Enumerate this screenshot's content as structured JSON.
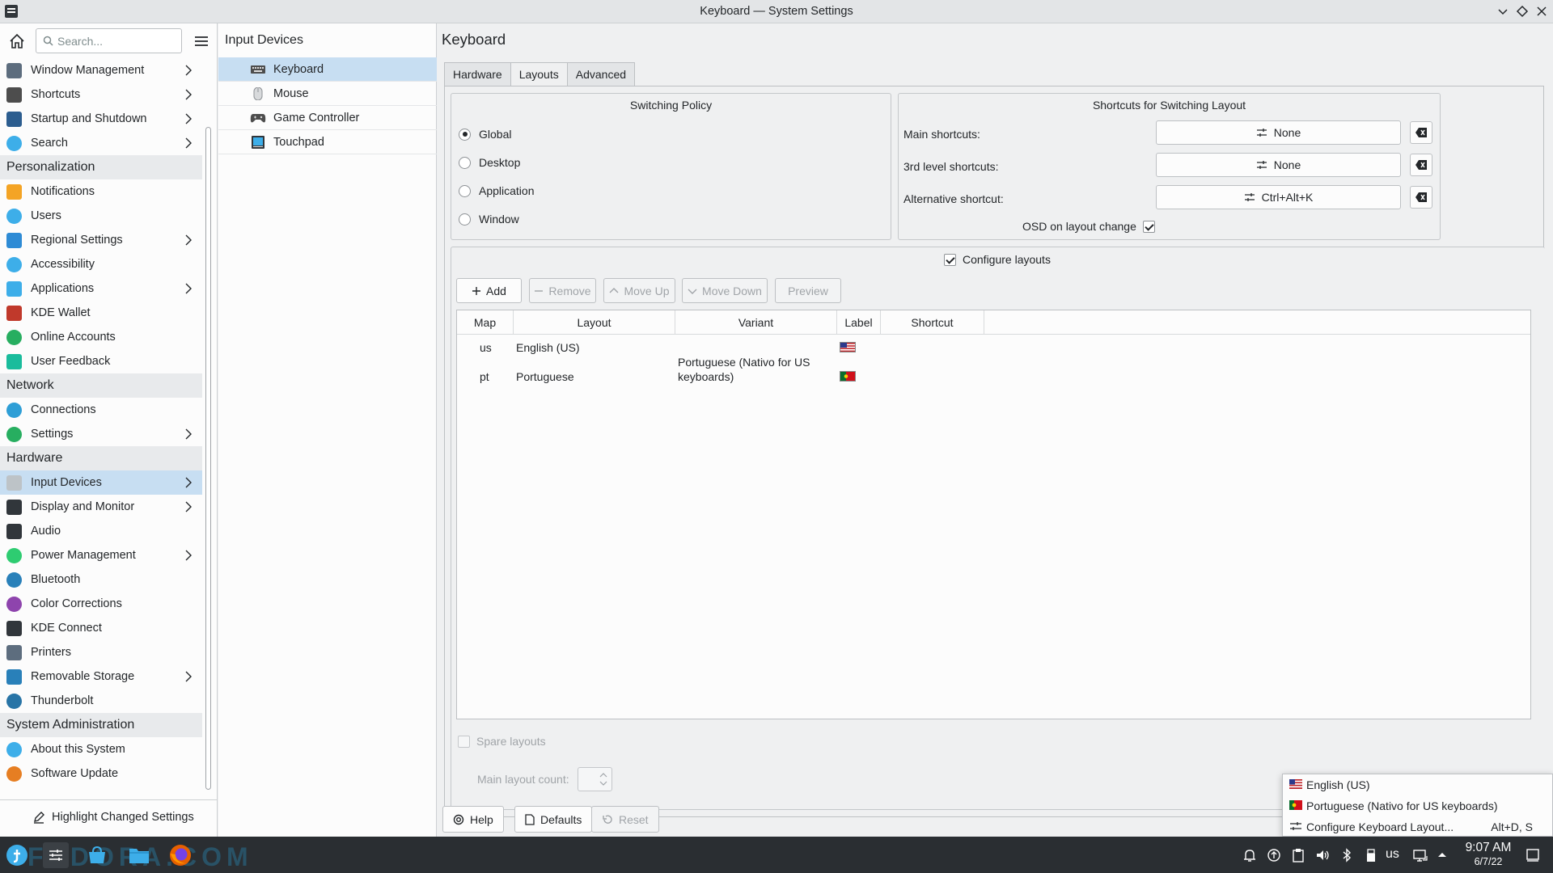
{
  "window": {
    "title": "Keyboard — System Settings"
  },
  "sidebar": {
    "search_placeholder": "Search...",
    "items": [
      {
        "label": "Window Management",
        "icon": "window-icon",
        "chev": true
      },
      {
        "label": "Shortcuts",
        "icon": "keyboard-icon",
        "chev": true
      },
      {
        "label": "Startup and Shutdown",
        "icon": "startup-icon",
        "chev": true
      },
      {
        "label": "Search",
        "icon": "search-icon",
        "chev": true
      },
      {
        "label": "Personalization",
        "cat": true
      },
      {
        "label": "Notifications",
        "icon": "bell-icon"
      },
      {
        "label": "Users",
        "icon": "user-icon"
      },
      {
        "label": "Regional Settings",
        "icon": "flag-icon",
        "chev": true
      },
      {
        "label": "Accessibility",
        "icon": "accessibility-icon"
      },
      {
        "label": "Applications",
        "icon": "applications-icon",
        "chev": true
      },
      {
        "label": "KDE Wallet",
        "icon": "wallet-icon"
      },
      {
        "label": "Online Accounts",
        "icon": "globe-icon"
      },
      {
        "label": "User Feedback",
        "icon": "feedback-icon"
      },
      {
        "label": "Network",
        "cat": true
      },
      {
        "label": "Connections",
        "icon": "network-icon"
      },
      {
        "label": "Settings",
        "icon": "network-settings-icon",
        "chev": true
      },
      {
        "label": "Hardware",
        "cat": true
      },
      {
        "label": "Input Devices",
        "icon": "mouse-icon",
        "chev": true,
        "selected": true
      },
      {
        "label": "Display and Monitor",
        "icon": "monitor-icon",
        "chev": true
      },
      {
        "label": "Audio",
        "icon": "audio-icon"
      },
      {
        "label": "Power Management",
        "icon": "power-icon",
        "chev": true
      },
      {
        "label": "Bluetooth",
        "icon": "bluetooth-icon"
      },
      {
        "label": "Color Corrections",
        "icon": "color-icon"
      },
      {
        "label": "KDE Connect",
        "icon": "phone-icon"
      },
      {
        "label": "Printers",
        "icon": "printer-icon"
      },
      {
        "label": "Removable Storage",
        "icon": "usb-icon",
        "chev": true
      },
      {
        "label": "Thunderbolt",
        "icon": "thunderbolt-icon"
      },
      {
        "label": "System Administration",
        "cat": true
      },
      {
        "label": "About this System",
        "icon": "info-icon"
      },
      {
        "label": "Software Update",
        "icon": "update-icon"
      }
    ],
    "highlight_label": "Highlight Changed Settings"
  },
  "subpanel": {
    "title": "Input Devices",
    "items": [
      {
        "label": "Keyboard",
        "selected": true
      },
      {
        "label": "Mouse"
      },
      {
        "label": "Game Controller"
      },
      {
        "label": "Touchpad"
      }
    ]
  },
  "main": {
    "title": "Keyboard",
    "tabs": [
      "Hardware",
      "Layouts",
      "Advanced"
    ],
    "active_tab": "Layouts",
    "switching": {
      "title": "Switching Policy",
      "options": [
        "Global",
        "Desktop",
        "Application",
        "Window"
      ],
      "selected": "Global"
    },
    "shortcuts": {
      "title": "Shortcuts for Switching Layout",
      "rows": [
        {
          "label": "Main shortcuts:",
          "value": "None"
        },
        {
          "label": "3rd level shortcuts:",
          "value": "None"
        },
        {
          "label": "Alternative shortcut:",
          "value": "Ctrl+Alt+K"
        }
      ],
      "osd_label": "OSD on layout change",
      "osd_checked": true
    },
    "configure_label": "Configure layouts",
    "configure_checked": true,
    "toolbar": {
      "add": "Add",
      "remove": "Remove",
      "move_up": "Move Up",
      "move_down": "Move Down",
      "preview": "Preview"
    },
    "table": {
      "headers": [
        "Map",
        "Layout",
        "Variant",
        "Label",
        "Shortcut"
      ],
      "rows": [
        {
          "map": "us",
          "layout": "English (US)",
          "variant": "",
          "label": "us-flag"
        },
        {
          "map": "pt",
          "layout": "Portuguese",
          "variant_line1": "Portuguese (Nativo for US",
          "variant_line2": "keyboards)",
          "label": "pt-flag"
        }
      ]
    },
    "spare_label": "Spare layouts",
    "main_count_label": "Main layout count:",
    "buttons": {
      "help": "Help",
      "defaults": "Defaults",
      "reset": "Reset"
    }
  },
  "popup": {
    "items": [
      {
        "label": "English (US)"
      },
      {
        "label": "Portuguese (Nativo for US keyboards)"
      },
      {
        "label": "Configure Keyboard Layout...",
        "shortcut": "Alt+D, S"
      }
    ]
  },
  "taskbar": {
    "keyboard_indicator": "us",
    "time": "9:07 AM",
    "date": "6/7/22",
    "watermark": "FEDORA.COM"
  }
}
